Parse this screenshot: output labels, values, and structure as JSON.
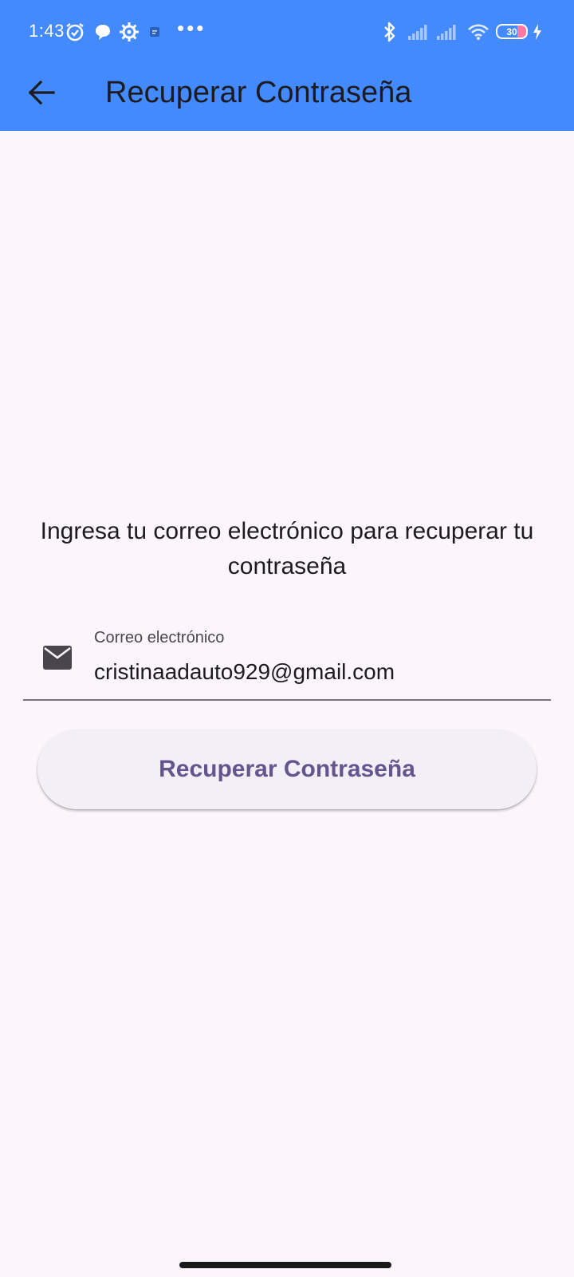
{
  "status_bar": {
    "time": "1:43",
    "overflow_indicator": "•••",
    "battery_level": "30",
    "icons": [
      "alarm-icon",
      "chat-bubble-icon",
      "settings-gear-icon",
      "app-notification-icon",
      "bluetooth-icon",
      "signal-icon",
      "signal-icon",
      "wifi-icon",
      "battery-icon",
      "charging-icon"
    ]
  },
  "app_bar": {
    "title": "Recuperar Contraseña",
    "back_icon": "arrow-back-icon"
  },
  "content": {
    "instructions": "Ingresa tu correo electrónico para recuperar tu contraseña",
    "email_field": {
      "label": "Correo electrónico",
      "value": "cristinaadauto929@gmail.com",
      "icon": "email-icon"
    },
    "submit_button_label": "Recuperar Contraseña"
  },
  "colors": {
    "app_bar": "#448aff",
    "background": "#fcf6fc",
    "button_text": "#65558f",
    "button_bg": "#f4eff6",
    "underline": "#79747e"
  }
}
